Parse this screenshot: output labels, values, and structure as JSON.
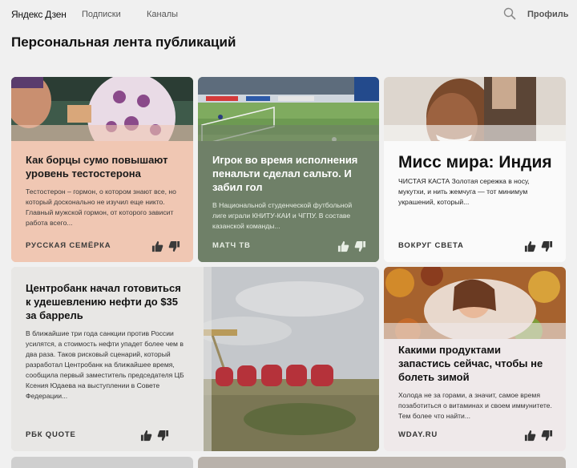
{
  "header": {
    "logo": "Яндекс Дзен",
    "nav": [
      "Подписки",
      "Каналы"
    ],
    "profile": "Профиль",
    "search_icon": "search-icon"
  },
  "page_title": "Персональная лента публикаций",
  "cards": [
    {
      "title": "Как борцы сумо повышают уровень тестостерона",
      "text": "Тестостерон – гормон, о котором знают все, но который досконально не изучил еще никто. Главный мужской гормон, от которого зависит работа всего...",
      "source": "РУССКАЯ СЕМЁРКА"
    },
    {
      "title": "Игрок во время исполнения пенальти сделал сальто. И забил гол",
      "text": "В Национальной студенческой футбольной лиге играли КНИТУ-КАИ и ЧГПУ. В составе казанской команды...",
      "source": "МАТЧ ТВ"
    },
    {
      "title": "Мисс мира: Индия",
      "text": "ЧИСТАЯ КАСТА Золотая сережка в носу, мукутхи, и нить жемчуга — тот минимум украшений, который...",
      "source": "ВОКРУГ СВЕТА"
    },
    {
      "title": "Центробанк начал готовиться к удешевлению нефти до $35 за баррель",
      "text": "В ближайшие три года санкции против России усилятся, а стоимость нефти упадет более чем в два раза. Таков рисковый сценарий, который разработал Центробанк на ближайшее время, сообщила первый заместитель председателя ЦБ Ксения Юдаева на выступлении в Совете Федерации...",
      "source": "РБК QUOTE"
    },
    {
      "title": "Какими продуктами запастись сейчас, чтобы не болеть зимой",
      "text": "Холода не за горами, а значит, самое время позаботиться о витаминах и своем иммунитете. Тем более что найти...",
      "source": "WDAY.RU"
    }
  ]
}
